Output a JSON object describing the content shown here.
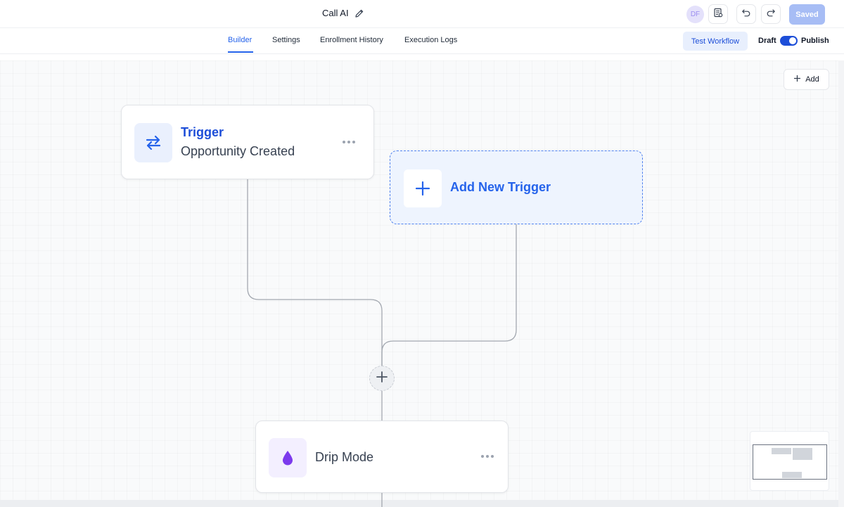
{
  "header": {
    "title": "Call AI",
    "avatar_initials": "DF",
    "saved_label": "Saved"
  },
  "tabs": [
    {
      "label": "Builder",
      "active": true
    },
    {
      "label": "Settings",
      "active": false
    },
    {
      "label": "Enrollment History",
      "active": false
    },
    {
      "label": "Execution Logs",
      "active": false
    }
  ],
  "actions": {
    "test_workflow_label": "Test Workflow",
    "draft_label": "Draft",
    "publish_label": "Publish",
    "publish_toggle_on": true
  },
  "canvas": {
    "add_label": "Add",
    "trigger_node": {
      "title": "Trigger",
      "subtitle": "Opportunity Created",
      "icon": "arrows-exchange-icon"
    },
    "add_trigger_node": {
      "label": "Add New Trigger",
      "icon": "plus-icon"
    },
    "insert_step": {
      "icon": "plus-icon"
    },
    "drip_node": {
      "label": "Drip Mode",
      "icon": "droplet-icon"
    }
  },
  "colors": {
    "accent": "#2563eb",
    "saved_button": "#a7bdf5",
    "drip_icon": "#7c3aed"
  }
}
